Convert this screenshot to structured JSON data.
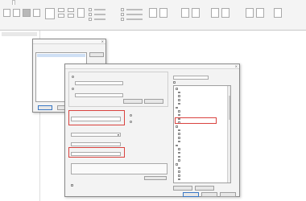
{
  "ribbon": {
    "tabs": [
      "",
      "",
      "",
      "",
      "",
      "",
      ""
    ],
    "active_tab": 3
  },
  "left_panel": {
    "items": [
      "",
      "",
      "",
      "",
      "",
      "",
      "",
      "",
      "",
      "",
      "",
      "",
      ""
    ]
  },
  "dialog_back": {
    "title": "",
    "prompt": "",
    "selected_item": "",
    "ok": "",
    "cancel": ""
  },
  "dialog_front": {
    "title": "",
    "section_data": "",
    "section_group": "",
    "name_label": "",
    "name_value": "",
    "type_label": "",
    "type_value": "",
    "group_label": "",
    "group_value": "",
    "right_header": "",
    "right_select": "",
    "right_check": "",
    "list_items": [
      "",
      "",
      "",
      "",
      "",
      "",
      "",
      "",
      "",
      "",
      "",
      "",
      "",
      "",
      "",
      "",
      "",
      "",
      "",
      "",
      "",
      "",
      "",
      "",
      ""
    ],
    "highlight_index": 11,
    "bottom_check": "",
    "ok": "",
    "cancel": "",
    "help": ""
  },
  "colors": {
    "highlight": "#d9433f",
    "selection": "#3a78c4"
  }
}
